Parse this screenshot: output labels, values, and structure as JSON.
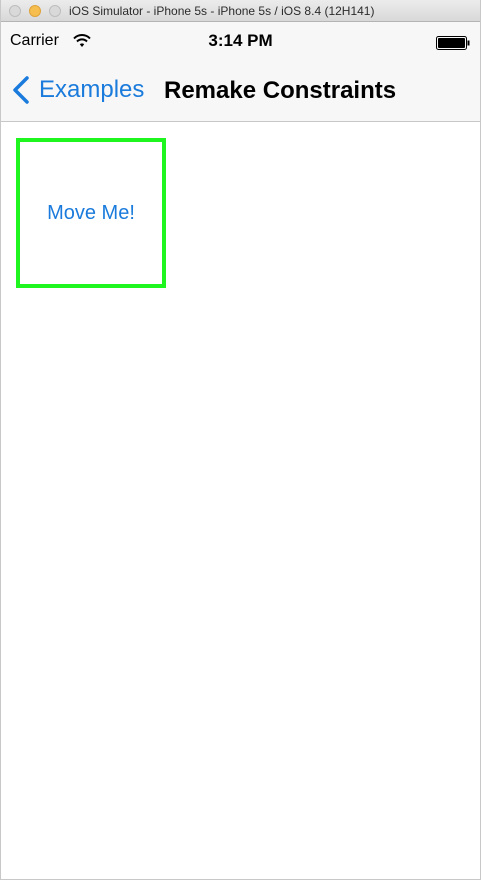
{
  "window": {
    "title": "iOS Simulator - iPhone 5s - iPhone 5s / iOS 8.4 (12H141)"
  },
  "status_bar": {
    "carrier": "Carrier",
    "time": "3:14 PM",
    "wifi_icon": "wifi-icon",
    "battery_icon": "battery-full-icon"
  },
  "nav_bar": {
    "back_label": "Examples",
    "back_icon": "chevron-left-icon",
    "title": "Remake Constraints",
    "tint_color": "#1a7bdc"
  },
  "content": {
    "button_label": "Move Me!",
    "button_border_color": "#1ff51f"
  }
}
